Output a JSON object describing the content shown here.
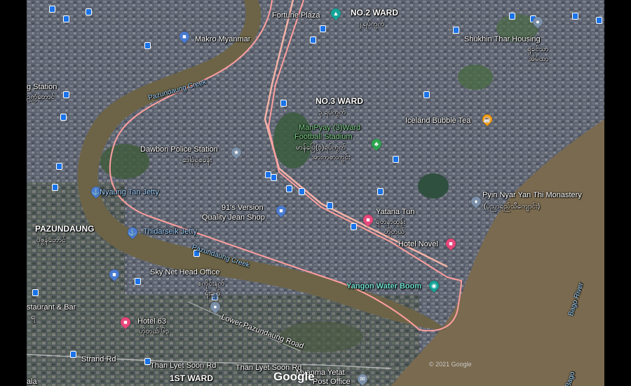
{
  "map": {
    "labels": {
      "no2_ward": "NO.2 WARD",
      "no2_ward_my": "၂ ရပ်ကွက်",
      "fortune_plaza": "Fortune Plaza",
      "makro": "Makro Myanmar",
      "shukhin": "Shukhin Thar Housing",
      "shukhin_my1": "ရှုခင်သာ",
      "shukhin_my2": "အိမ်ယာ",
      "station": "g Station",
      "station_my": "ဥက္ကံတောင်",
      "pazundaung_creek_top": "Pazundaung Creek",
      "no3_ward": "NO.3 WARD",
      "no3_ward_my": "၃ ရပ်ကွက်",
      "manpyay1": "ManPyay (3)Ward",
      "manpyay2": "Football Stadium",
      "manpyay_my1": "မာန်ပြေ(၃)ရပ်ကွက်",
      "manpyay_my2": "အားကစားကွင်း",
      "iceland": "Iceland Bubble Tea",
      "dawbon": "Dawbon Police Station",
      "dawbon_my": "ဒေါပုံရဲစခန်း",
      "nyaung_tan": "Nyaung Tan Jetty",
      "pyin_nyar1": "Pyin Nyar Yan Thi Monastery",
      "pyin_nyar2": "(ပညာရည်သီကျောင်း)",
      "version1": "91's Version",
      "version2": "Quality Jean Shop",
      "yatana": "Yatana Tun",
      "yatana_my1": "ရတနာထွန်း",
      "yatana_my2": "ဟိုတယ်",
      "pazundaung": "PAZUNDAUNG",
      "pazundaung_my": "ပုဇွန်တောင်",
      "thidarseik": "Thidarseik Jetty",
      "hotel_novel": "Hotel Novel",
      "pazundaung_creek_mid": "Pazundaung Creek",
      "skynet1": "Sky Net Head Office",
      "skynet_my1": "စကိုင်းနက်",
      "skynet_my2": "ရုံးချုပ်",
      "yangon_water": "Yangon Water Boom",
      "restaurant1": "staurant & Bar",
      "restaurant2": "ရ",
      "bago_river1": "Bago River",
      "bago_river2": "Bago",
      "hotel63": "Hotel 63",
      "hotel63_my": "ဟိုတယ် ၆၃",
      "lower_paz_road": "Lower Pazundaung Road",
      "strand_rd": "Strand Rd",
      "than_lyet1": "Than Lyet Soon Rd",
      "than_lyet2": "Than Lyet Soon Rd",
      "first_ward": "1ST WARD",
      "myanma_yetat1": "Myanma Yetat",
      "myanma_yetat2": "Post Office",
      "ala": "ala"
    },
    "google_logo": "Google",
    "copyright": "© 2021 Google",
    "colors": {
      "boundary": "#e88a8a",
      "river": "#7a6a4f",
      "hotel_pin": "#e8477b",
      "attraction_pin": "#16a398",
      "service_pin": "#7b8fa8",
      "food_pin": "#f39c12",
      "park_pin": "#2ea44f",
      "bus_icon": "#1a73e8"
    }
  }
}
